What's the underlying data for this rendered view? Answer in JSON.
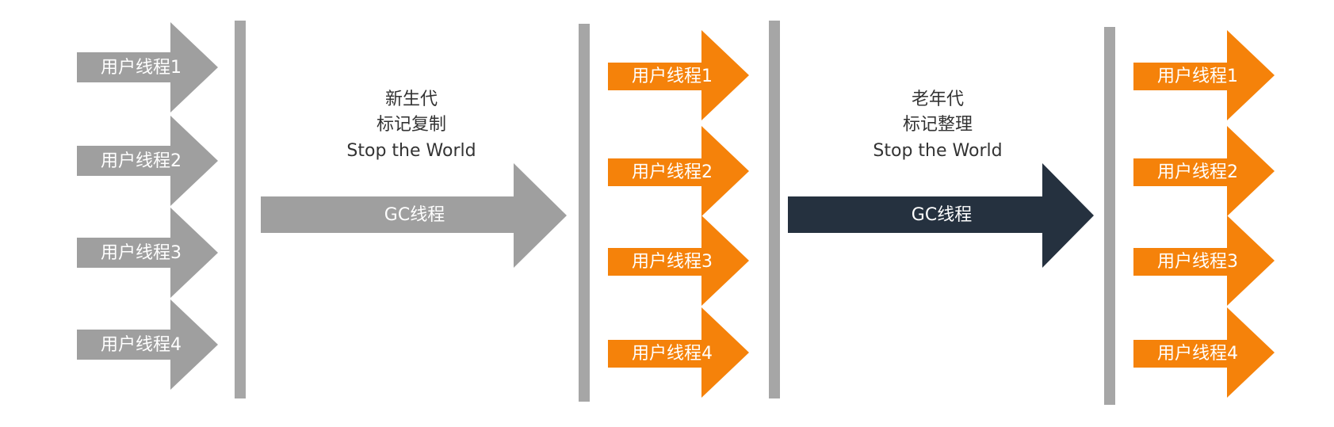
{
  "colors": {
    "gray": "#9f9f9f",
    "orange": "#f5820a",
    "dark": "#25313f",
    "bar": "#a6a6a6",
    "text": "#333333"
  },
  "stages": [
    {
      "threads": [
        "用户线程1",
        "用户线程2",
        "用户线程3",
        "用户线程4"
      ],
      "color": "gray"
    },
    {
      "threads": [
        "用户线程1",
        "用户线程2",
        "用户线程3",
        "用户线程4"
      ],
      "color": "orange"
    },
    {
      "threads": [
        "用户线程1",
        "用户线程2",
        "用户线程3",
        "用户线程4"
      ],
      "color": "orange"
    }
  ],
  "phases": [
    {
      "lines": [
        "新生代",
        "标记复制",
        "Stop the World"
      ],
      "gc_label": "GC线程",
      "color": "gray"
    },
    {
      "lines": [
        "老年代",
        "标记整理",
        "Stop the World"
      ],
      "gc_label": "GC线程",
      "color": "dark"
    }
  ]
}
